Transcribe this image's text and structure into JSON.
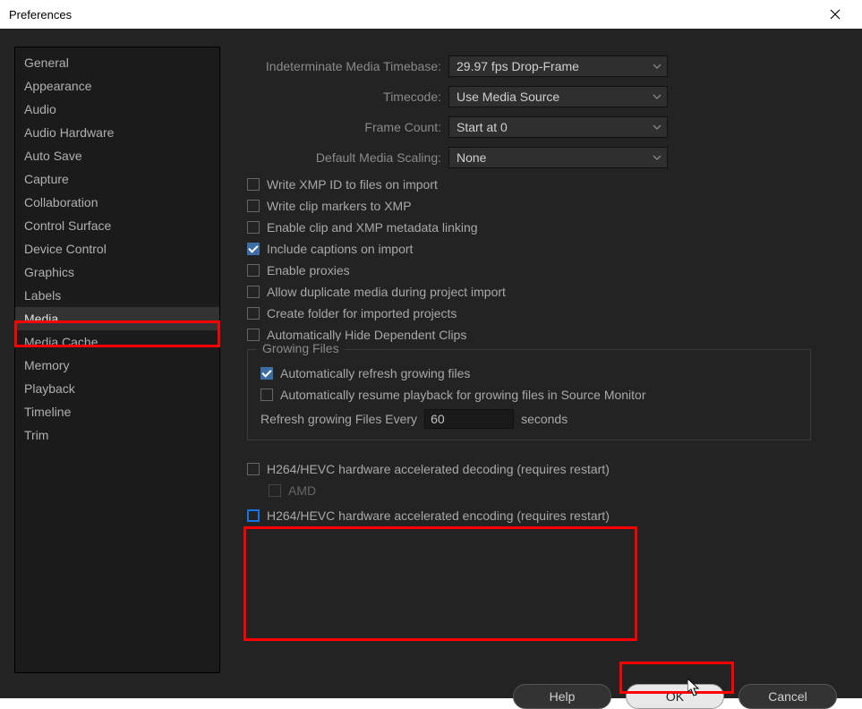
{
  "window": {
    "title": "Preferences"
  },
  "sidebar": {
    "items": [
      {
        "label": "General"
      },
      {
        "label": "Appearance"
      },
      {
        "label": "Audio"
      },
      {
        "label": "Audio Hardware"
      },
      {
        "label": "Auto Save"
      },
      {
        "label": "Capture"
      },
      {
        "label": "Collaboration"
      },
      {
        "label": "Control Surface"
      },
      {
        "label": "Device Control"
      },
      {
        "label": "Graphics"
      },
      {
        "label": "Labels"
      },
      {
        "label": "Media"
      },
      {
        "label": "Media Cache"
      },
      {
        "label": "Memory"
      },
      {
        "label": "Playback"
      },
      {
        "label": "Timeline"
      },
      {
        "label": "Trim"
      }
    ],
    "selected": "Media"
  },
  "dropdowns": {
    "timebase": {
      "label": "Indeterminate Media Timebase:",
      "value": "29.97 fps Drop-Frame"
    },
    "timecode": {
      "label": "Timecode:",
      "value": "Use Media Source"
    },
    "frame_count": {
      "label": "Frame Count:",
      "value": "Start at 0"
    },
    "scaling": {
      "label": "Default Media Scaling:",
      "value": "None"
    }
  },
  "checks": {
    "write_xmp": {
      "label": "Write XMP ID to files on import",
      "checked": false
    },
    "write_clip_markers": {
      "label": "Write clip markers to XMP",
      "checked": false
    },
    "enable_clip_xmp": {
      "label": "Enable clip and XMP metadata linking",
      "checked": false
    },
    "include_captions": {
      "label": "Include captions on import",
      "checked": true
    },
    "enable_proxies": {
      "label": "Enable proxies",
      "checked": false
    },
    "allow_duplicate": {
      "label": "Allow duplicate media during project import",
      "checked": false
    },
    "create_folder": {
      "label": "Create folder for imported projects",
      "checked": false
    },
    "auto_hide_clips": {
      "label": "Automatically Hide Dependent Clips",
      "checked": false
    }
  },
  "growing": {
    "title": "Growing Files",
    "auto_refresh": {
      "label": "Automatically refresh growing files",
      "checked": true
    },
    "auto_resume": {
      "label": "Automatically resume playback for growing files in Source Monitor",
      "checked": false
    },
    "refresh_label_pre": "Refresh growing Files Every",
    "refresh_value": "60",
    "refresh_label_post": "seconds"
  },
  "hardware": {
    "decode": {
      "label": "H264/HEVC hardware accelerated decoding (requires restart)",
      "checked": false
    },
    "amd": {
      "label": "AMD",
      "checked": false,
      "disabled": true
    },
    "encode": {
      "label": "H264/HEVC hardware accelerated encoding (requires restart)",
      "checked": false
    }
  },
  "footer": {
    "help": "Help",
    "ok": "OK",
    "cancel": "Cancel"
  }
}
